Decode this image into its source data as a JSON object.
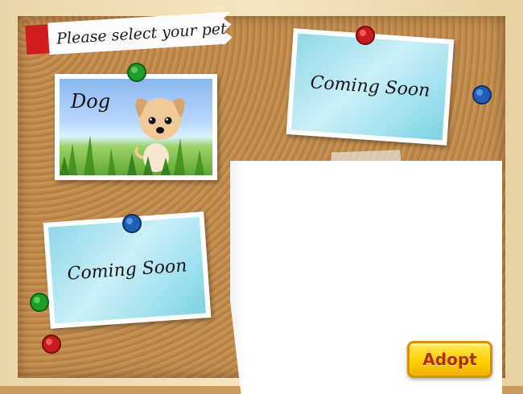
{
  "header": {
    "title": "Please select your pet"
  },
  "cards": [
    {
      "label": "Dog",
      "type": "pet",
      "available": true
    },
    {
      "label": "Coming Soon",
      "type": "placeholder",
      "available": false
    },
    {
      "label": "Coming Soon",
      "type": "placeholder",
      "available": false
    }
  ],
  "actions": {
    "adopt_label": "Adopt"
  },
  "colors": {
    "title_tab": "#d11d1d",
    "pin_red": "#c81c1c",
    "pin_green": "#1f9c2a",
    "pin_blue": "#1f5fb6",
    "button_face": "#ffd000",
    "button_text": "#b82a00",
    "cork": "#c08c50",
    "frame": "#f0e0b4"
  },
  "pins": [
    {
      "color": "green",
      "icon": "green-pushpin-icon"
    },
    {
      "color": "red",
      "icon": "red-pushpin-icon"
    },
    {
      "color": "blue",
      "icon": "blue-pushpin-icon"
    },
    {
      "color": "blue",
      "icon": "blue-pushpin-icon"
    },
    {
      "color": "green",
      "icon": "green-pushpin-icon"
    },
    {
      "color": "red",
      "icon": "red-pushpin-icon"
    }
  ]
}
